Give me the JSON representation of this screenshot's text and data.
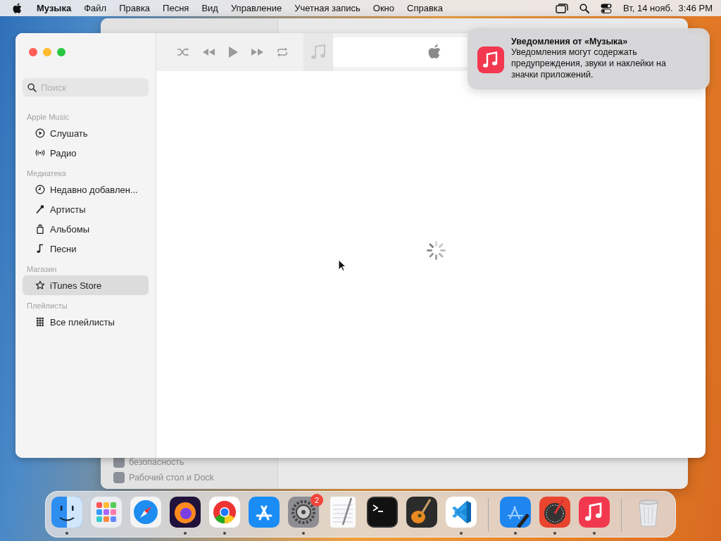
{
  "menu_bar": {
    "app_name": "Музыка",
    "menus": [
      "Файл",
      "Правка",
      "Песня",
      "Вид",
      "Управление",
      "Учетная запись",
      "Окно",
      "Справка"
    ],
    "date": "Вт, 14 нояб.",
    "time": "3:46 PM"
  },
  "background_window": {
    "items": [
      "безопасность",
      "Рабочий стол и Dock"
    ]
  },
  "window": {
    "sidebar": {
      "search": {
        "placeholder": "Поиск"
      },
      "sections": [
        {
          "title": "Apple Music",
          "items": [
            {
              "label": "Слушать",
              "kind": "play",
              "selected": false
            },
            {
              "label": "Радио",
              "kind": "radio",
              "selected": false
            }
          ]
        },
        {
          "title": "Медиатека",
          "items": [
            {
              "label": "Недавно добавлен...",
              "kind": "clock",
              "selected": false
            },
            {
              "label": "Артисты",
              "kind": "mic",
              "selected": false
            },
            {
              "label": "Альбомы",
              "kind": "album",
              "selected": false
            },
            {
              "label": "Песни",
              "kind": "note",
              "selected": false
            }
          ]
        },
        {
          "title": "Магазин",
          "items": [
            {
              "label": "iTunes Store",
              "kind": "star",
              "selected": true
            }
          ]
        },
        {
          "title": "Плейлисты",
          "items": [
            {
              "label": "Все плейлисты",
              "kind": "grid",
              "selected": false
            }
          ]
        }
      ]
    },
    "content": {
      "loading": true
    }
  },
  "notification": {
    "title": "Уведомления от «Музыка»",
    "body": "Уведомления могут содержать предупреждения, звуки и наклейки на значки приложений."
  },
  "dock": {
    "sections": [
      {
        "items": [
          {
            "kind": "finder",
            "running": true
          },
          {
            "kind": "launchpad",
            "running": false
          },
          {
            "kind": "safari",
            "running": false
          },
          {
            "kind": "firefox",
            "running": true
          },
          {
            "kind": "chrome",
            "running": true
          },
          {
            "kind": "appstore",
            "running": false
          },
          {
            "kind": "settings",
            "running": true,
            "badge": "2"
          },
          {
            "kind": "textedit",
            "running": false
          },
          {
            "kind": "terminal",
            "running": false
          },
          {
            "kind": "garageband",
            "running": false
          },
          {
            "kind": "vscode",
            "running": true
          }
        ]
      },
      {
        "items": [
          {
            "kind": "xcode",
            "running": true
          },
          {
            "kind": "colormeter",
            "running": true
          },
          {
            "kind": "music",
            "running": true
          }
        ]
      },
      {
        "items": [
          {
            "kind": "trash",
            "running": false
          }
        ]
      }
    ]
  }
}
